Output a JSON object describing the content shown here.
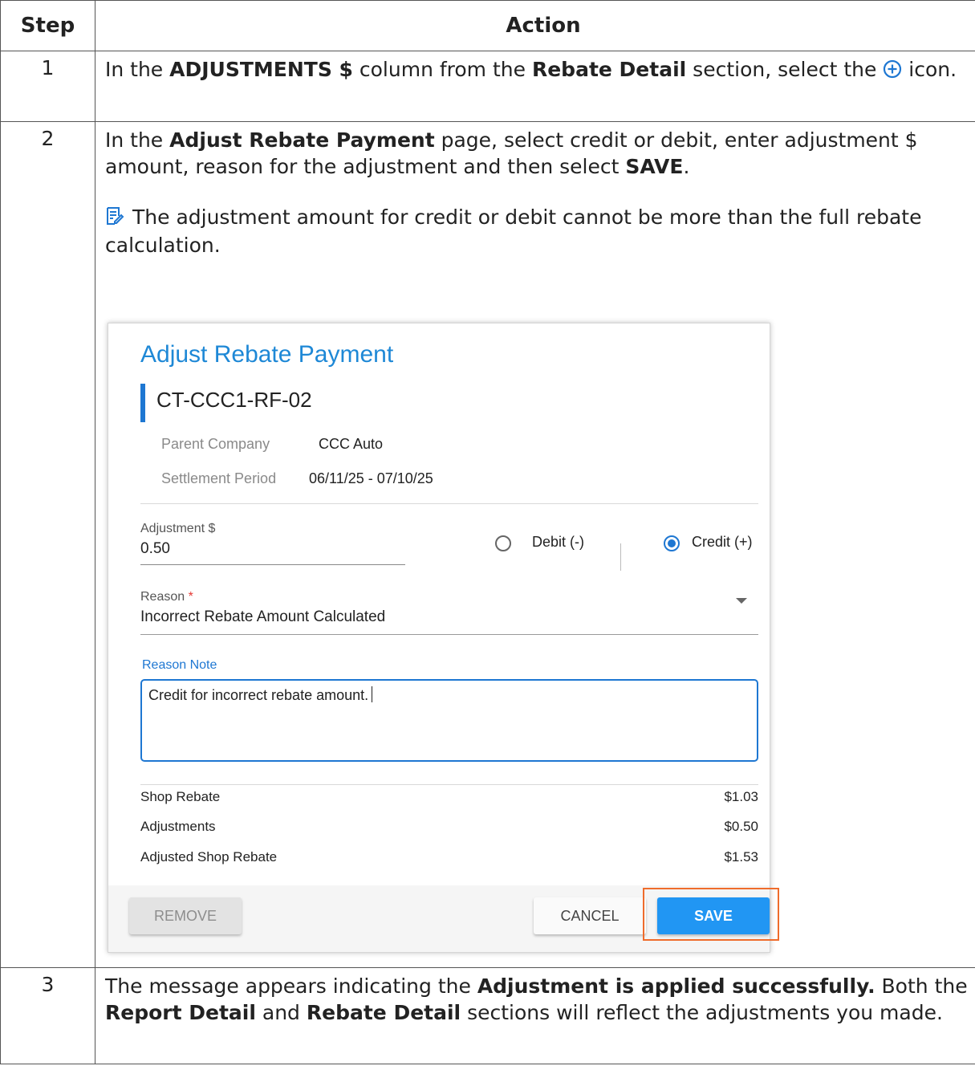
{
  "table": {
    "header_step": "Step",
    "header_action": "Action"
  },
  "rows": [
    {
      "step": "1",
      "t1": "In the ",
      "b1": "ADJUSTMENTS $",
      "t2": " column from the ",
      "b2": "Rebate Detail",
      "t3": " section, select the ",
      "t4": " icon."
    },
    {
      "step": "2",
      "t1": "In the ",
      "b1": "Adjust Rebate Payment",
      "t2": " page, select credit or debit, enter adjustment $ amount, reason for the adjustment and then select ",
      "b2": "SAVE",
      "t3": ".",
      "note": "The adjustment amount for credit or debit cannot be more than the full rebate calculation."
    },
    {
      "step": "3",
      "t1": "The message appears indicating the ",
      "b1": "Adjustment is applied successfully.",
      "t2": " Both the ",
      "b2": "Report Detail",
      "t3": " and ",
      "b3": "Rebate Detail",
      "t4": " sections will reflect the adjustments you made."
    }
  ],
  "dialog": {
    "title": "Adjust Rebate Payment",
    "subtitle": "CT-CCC1-RF-02",
    "parent_company_label": "Parent Company",
    "parent_company_value": "CCC Auto",
    "settlement_period_label": "Settlement Period",
    "settlement_period_value": "06/11/25 - 07/10/25",
    "adjustment_label": "Adjustment $",
    "adjustment_value": "0.50",
    "debit_label": "Debit (-)",
    "credit_label": "Credit (+)",
    "selected_option": "credit",
    "reason_label": "Reason",
    "reason_required_mark": "*",
    "reason_value": "Incorrect Rebate Amount Calculated",
    "reason_note_label": "Reason Note",
    "reason_note_value": "Credit for incorrect rebate amount.",
    "summary": [
      {
        "label": "Shop Rebate",
        "value": "$1.03"
      },
      {
        "label": "Adjustments",
        "value": "$0.50"
      },
      {
        "label": "Adjusted Shop Rebate",
        "value": "$1.53"
      }
    ],
    "remove_label": "REMOVE",
    "cancel_label": "CANCEL",
    "save_label": "SAVE"
  },
  "colors": {
    "accent": "#1e77d2",
    "save_button": "#2196f3",
    "highlight": "#ef6c2c"
  },
  "icons": {
    "add": "plus-circle-icon",
    "note": "note-icon"
  }
}
